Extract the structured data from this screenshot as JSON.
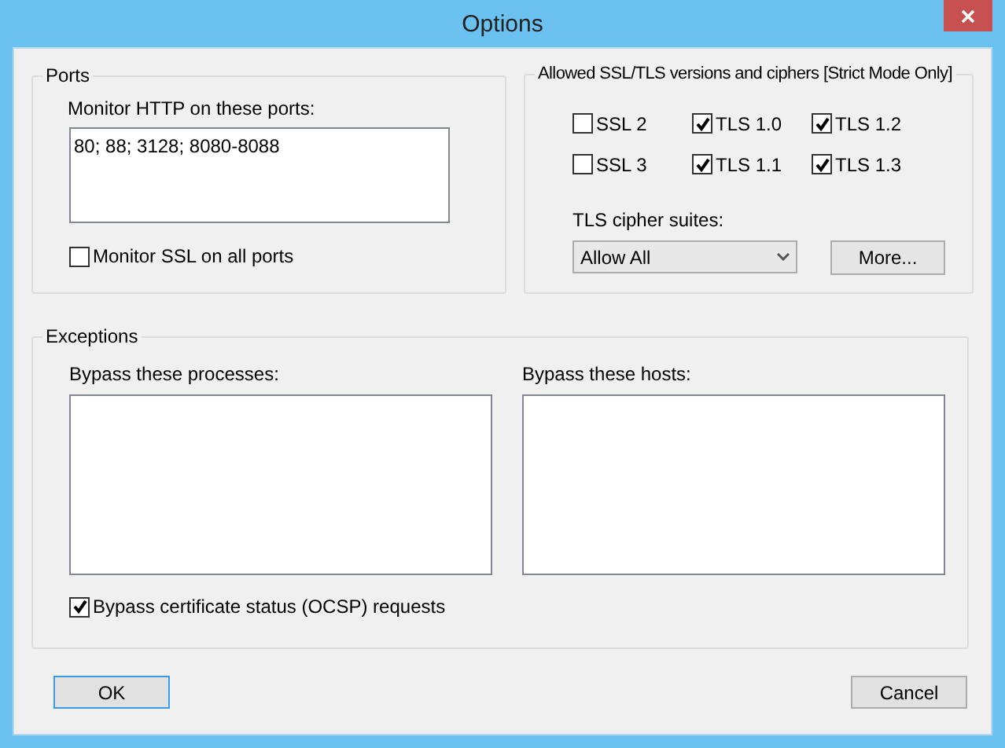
{
  "window": {
    "title": "Options"
  },
  "ports": {
    "title": "Ports",
    "label": "Monitor HTTP on these ports:",
    "value": "80; 88; 3128; 8080-8088",
    "monitor_ssl": {
      "label": "Monitor SSL on all ports",
      "checked": false
    }
  },
  "ssl": {
    "title": "Allowed SSL/TLS versions and ciphers [Strict Mode Only]",
    "versions": [
      {
        "label": "SSL 2",
        "checked": false
      },
      {
        "label": "TLS 1.0",
        "checked": true
      },
      {
        "label": "TLS 1.2",
        "checked": true
      },
      {
        "label": "SSL 3",
        "checked": false
      },
      {
        "label": "TLS 1.1",
        "checked": true
      },
      {
        "label": "TLS 1.3",
        "checked": true
      }
    ],
    "cipher_label": "TLS cipher suites:",
    "cipher_value": "Allow All",
    "more_button": "More..."
  },
  "exceptions": {
    "title": "Exceptions",
    "processes_label": "Bypass these processes:",
    "hosts_label": "Bypass these hosts:",
    "bypass_ocsp": {
      "label": "Bypass certificate status (OCSP) requests",
      "checked": true
    }
  },
  "buttons": [
    {
      "label": "OK",
      "default": true
    },
    {
      "label": "Cancel",
      "default": false
    }
  ]
}
